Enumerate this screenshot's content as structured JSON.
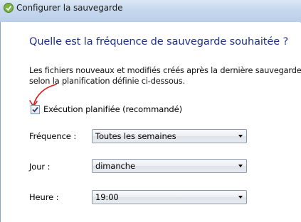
{
  "window": {
    "title": "Configurer la sauvegarde"
  },
  "content": {
    "heading": "Quelle est la fréquence de sauvegarde souhaitée ?",
    "description_line1": "Les fichiers nouveaux et modifiés créés après la dernière sauvegarde sero",
    "description_line2": "selon la planification définie ci-dessous.",
    "scheduled_checkbox": {
      "label": "Exécution planifiée (recommandé)",
      "checked": true
    },
    "frequency": {
      "label": "Fréquence :",
      "value": "Toutes les semaines"
    },
    "day": {
      "label": "Jour :",
      "value": "dimanche"
    },
    "time": {
      "label": "Heure :",
      "value": "19:00"
    }
  },
  "annotation": {
    "arrow_color": "#e0191a"
  },
  "icons": {
    "app": "backup-icon",
    "check": "checkmark-icon",
    "dropdown": "chevron-down-icon"
  }
}
